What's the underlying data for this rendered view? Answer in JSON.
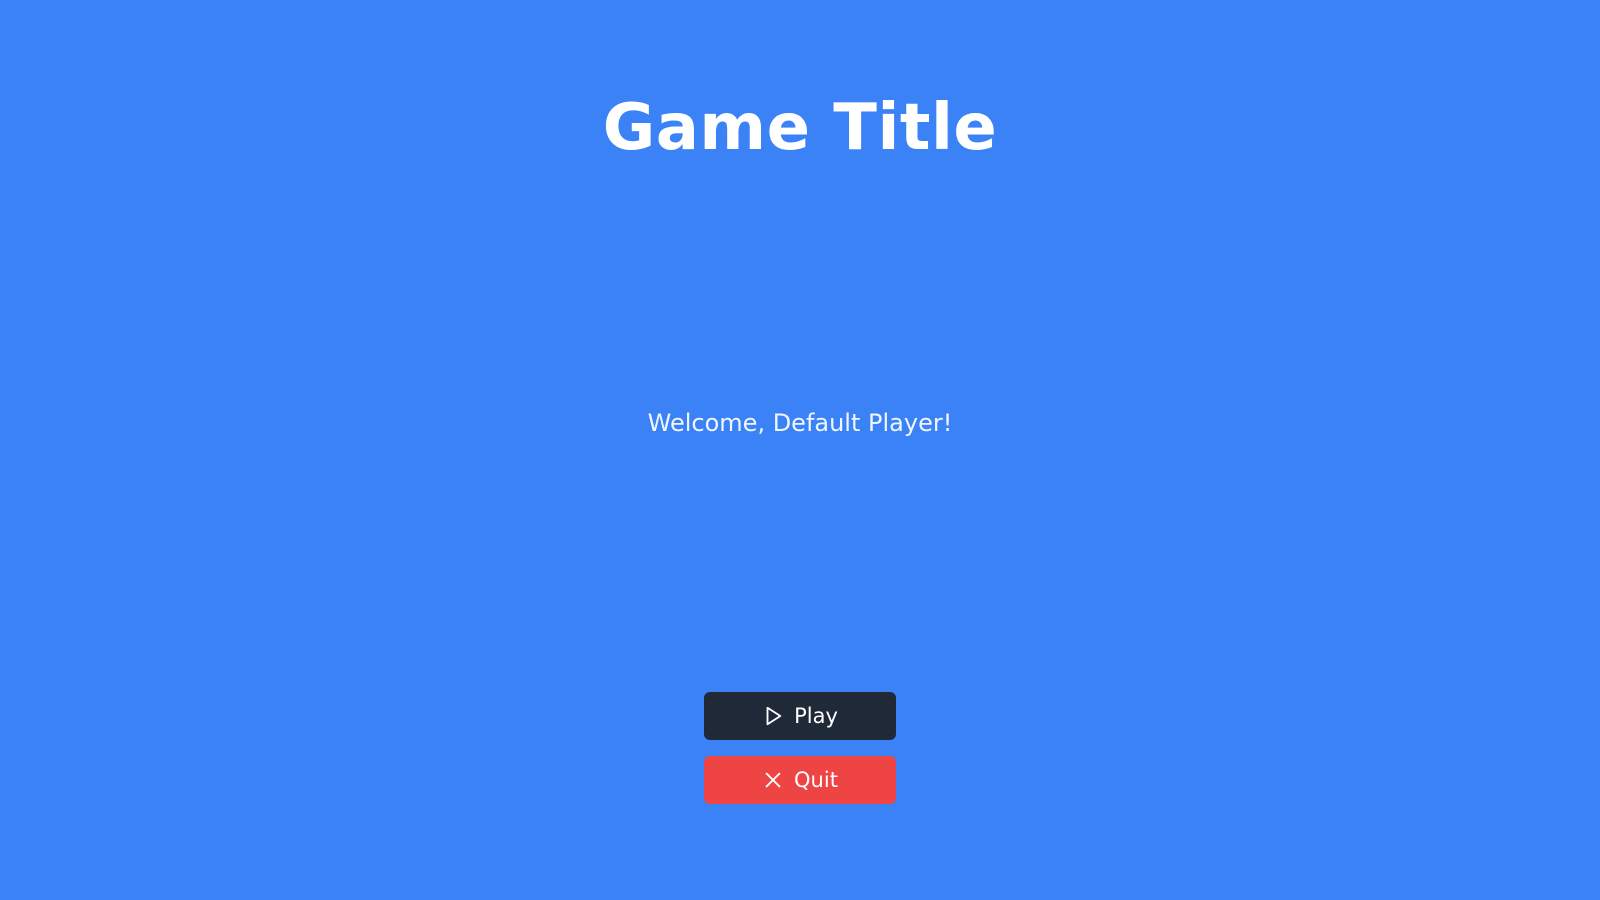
{
  "screen": {
    "title": "Game Title",
    "welcome": "Welcome, Default Player!",
    "background_color": "#3b82f6"
  },
  "menu": {
    "play": {
      "label": "Play",
      "icon": "play-icon",
      "color": "#1f2937"
    },
    "quit": {
      "label": "Quit",
      "icon": "close-icon",
      "color": "#ef4444"
    }
  }
}
